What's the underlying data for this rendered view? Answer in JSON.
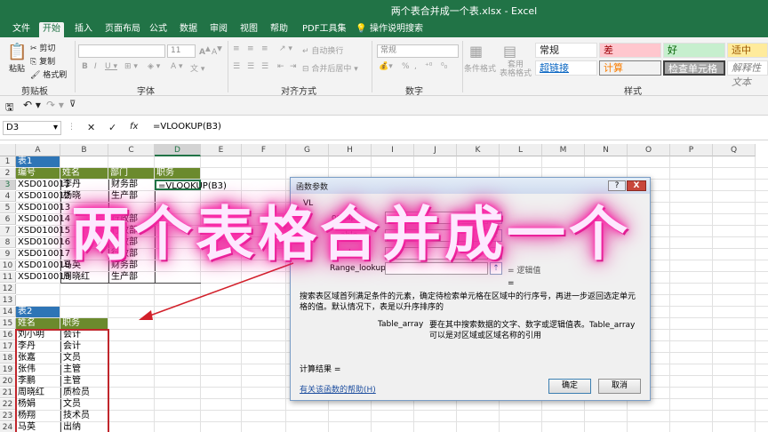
{
  "window": {
    "title": "两个表合并成一个表.xlsx  -  Excel"
  },
  "tabs": [
    "文件",
    "开始",
    "插入",
    "页面布局",
    "公式",
    "数据",
    "审阅",
    "视图",
    "帮助",
    "PDF工具集",
    "操作说明搜索"
  ],
  "active_tab": "开始",
  "ribbon": {
    "clipboard": {
      "cut": "剪切",
      "copy": "复制",
      "format_painter": "格式刷",
      "paste": "粘贴",
      "group": "剪贴板"
    },
    "font": {
      "name_value": "",
      "size_value": "11",
      "group": "字体"
    },
    "alignment": {
      "wrap": "自动换行",
      "merge": "合并后居中",
      "group": "对齐方式"
    },
    "number": {
      "format_value": "常规",
      "group": "数字"
    },
    "styles": {
      "conditional": "条件格式",
      "table_format": "套用\n表格格式",
      "cells": [
        "常规",
        "差",
        "好",
        "适中",
        "超链接",
        "计算",
        "检查单元格",
        "解释性文本"
      ],
      "group": "样式"
    }
  },
  "formula_bar": {
    "name_box": "D3",
    "formula": "=VLOOKUP(B3)",
    "cancel": "✕",
    "enter": "✓",
    "fx": "fx"
  },
  "grid": {
    "columns": [
      "A",
      "B",
      "C",
      "D",
      "E",
      "F",
      "G",
      "H",
      "I",
      "J",
      "K",
      "L",
      "M",
      "N",
      "O",
      "P",
      "Q"
    ],
    "rows": [
      "1",
      "2",
      "3",
      "4",
      "5",
      "6",
      "7",
      "8",
      "9",
      "10",
      "11",
      "12",
      "13",
      "14",
      "15",
      "16",
      "17",
      "18",
      "19",
      "20",
      "21",
      "22",
      "23",
      "24"
    ],
    "table1_title": "表1",
    "table1_headers": [
      "编号",
      "姓名",
      "部门",
      "职务"
    ],
    "table1_rows": [
      [
        "XSD010011",
        "李丹",
        "财务部",
        "=VLOOKUP(B3)"
      ],
      [
        "XSD010012",
        "杨晓",
        "生产部",
        ""
      ],
      [
        "XSD010013",
        "",
        "",
        ""
      ],
      [
        "XSD010014",
        "",
        "行政部",
        ""
      ],
      [
        "XSD010015",
        "",
        "行政部",
        ""
      ],
      [
        "XSD010016",
        "",
        "行政部",
        ""
      ],
      [
        "XSD010017",
        "",
        "行政部",
        ""
      ],
      [
        "XSD010018",
        "马英",
        "财务部",
        ""
      ],
      [
        "XSD010019",
        "周晓红",
        "生产部",
        ""
      ]
    ],
    "table2_title": "表2",
    "table2_headers": [
      "姓名",
      "职务"
    ],
    "table2_rows": [
      [
        "刘小明",
        "会计"
      ],
      [
        "李丹",
        "会计"
      ],
      [
        "张嘉",
        "文员"
      ],
      [
        "张伟",
        "主管"
      ],
      [
        "李鹏",
        "主管"
      ],
      [
        "周晓红",
        "质检员"
      ],
      [
        "杨娟",
        "文员"
      ],
      [
        "杨翔",
        "技术员"
      ],
      [
        "马英",
        "出纳"
      ]
    ]
  },
  "dialog": {
    "title": "函数参数",
    "section": "VL",
    "args": [
      "ookup",
      "able",
      "ndex",
      "Range_lookup"
    ],
    "range_lookup_value": "= 逻辑值",
    "equals": "=",
    "description": "搜索表区域首列满足条件的元素，确定待检索单元格在区域中的行序号，再进一步返回选定单元格的值。默认情况下，表是以升序排序的",
    "table_array_label": "Table_array",
    "table_array_desc": "要在其中搜索数据的文字、数字或逻辑值表。Table_array 可以是对区域或区域名称的引用",
    "result_label": "计算结果 =",
    "help_link": "有关该函数的帮助(H)",
    "ok": "确定",
    "cancel": "取消",
    "help_btn": "?",
    "close_btn": "X"
  },
  "overlay": {
    "headline": "两个表格合并成一个"
  },
  "colors": {
    "excel_green": "#217346",
    "header_green": "#6b8a2d",
    "header_blue": "#2e75b6",
    "red_box": "#c0262c",
    "neon": "#ff2fae"
  }
}
